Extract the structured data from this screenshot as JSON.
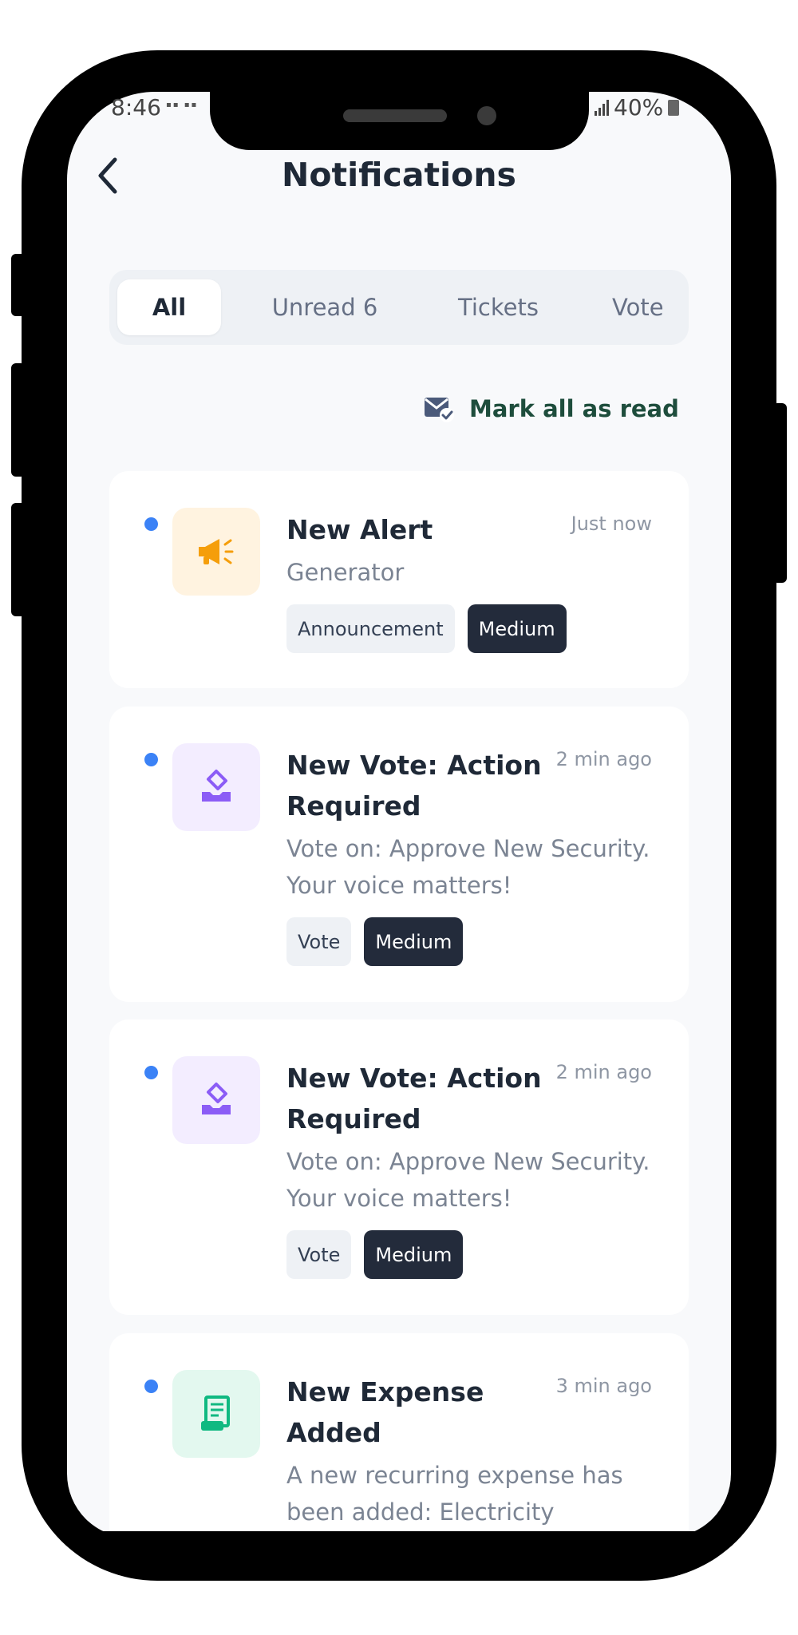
{
  "status_bar": {
    "time": "8:46",
    "battery": "40%"
  },
  "header": {
    "title": "Notifications"
  },
  "tabs": [
    {
      "label": "All"
    },
    {
      "label": "Unread 6"
    },
    {
      "label": "Tickets"
    },
    {
      "label": "Vote"
    }
  ],
  "mark_all": {
    "label": "Mark all as read"
  },
  "notifications": [
    {
      "title": "New Alert",
      "time": "Just now",
      "body": "Generator",
      "icon": "megaphone-icon",
      "tags": [
        {
          "label": "Announcement"
        },
        {
          "label": "Medium"
        }
      ]
    },
    {
      "title": "New Vote: Action Required",
      "time": "2 min ago",
      "body": "Vote on: Approve New Security. Your voice matters!",
      "icon": "ballot-box-icon",
      "tags": [
        {
          "label": "Vote"
        },
        {
          "label": "Medium"
        }
      ]
    },
    {
      "title": "New Vote: Action Required",
      "time": "2 min ago",
      "body": "Vote on: Approve New Security. Your voice matters!",
      "icon": "ballot-box-icon",
      "tags": [
        {
          "label": "Vote"
        },
        {
          "label": "Medium"
        }
      ]
    },
    {
      "title": "New Expense Added",
      "time": "3 min ago",
      "body": "A new recurring expense has been added: Electricity",
      "icon": "receipt-icon",
      "tags": []
    }
  ],
  "colors": {
    "unread_dot": "#3b82f6",
    "alert_icon_bg": "#fff3e0",
    "alert_icon": "#f59e0b",
    "vote_icon_bg": "#f3edff",
    "vote_icon": "#8b5cf6",
    "expense_icon_bg": "#e3f8ef",
    "expense_icon": "#10b981",
    "mark_all": "#1e4d3c",
    "priority_tag_bg": "#232b3b"
  }
}
